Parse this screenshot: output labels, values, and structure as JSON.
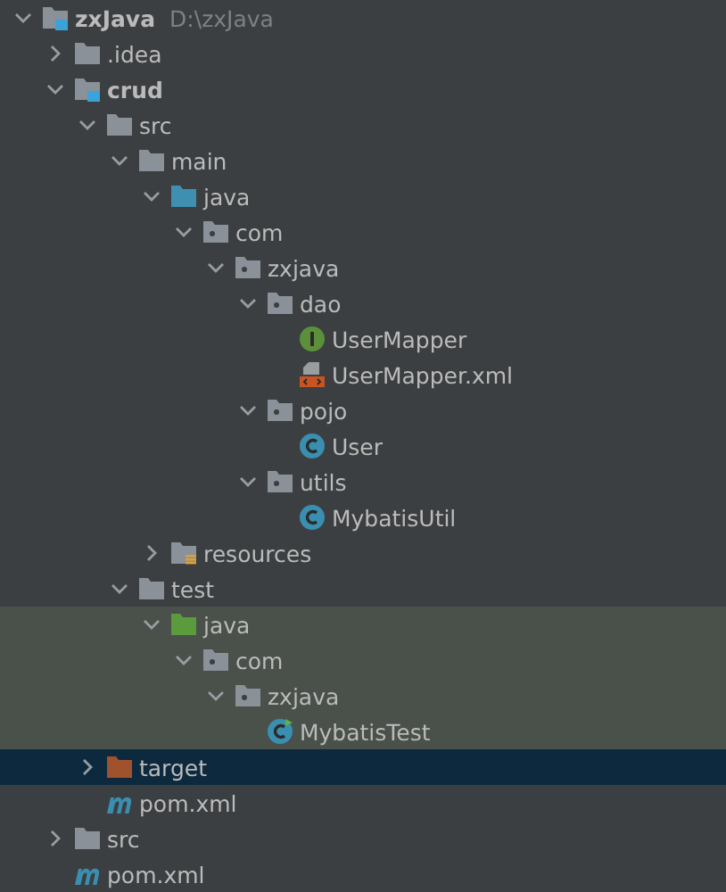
{
  "tree": [
    {
      "label": "zxJava",
      "path": "D:\\zxJava",
      "kind": "module",
      "expanded": true,
      "selected": false,
      "highlighted": false,
      "children": [
        {
          "label": ".idea",
          "kind": "folder",
          "expanded": false,
          "selected": false,
          "highlighted": false
        },
        {
          "label": "crud",
          "kind": "module",
          "expanded": true,
          "selected": false,
          "highlighted": false,
          "children": [
            {
              "label": "src",
              "kind": "folder",
              "expanded": true,
              "selected": false,
              "highlighted": false,
              "children": [
                {
                  "label": "main",
                  "kind": "folder",
                  "expanded": true,
                  "selected": false,
                  "highlighted": false,
                  "children": [
                    {
                      "label": "java",
                      "kind": "source",
                      "expanded": true,
                      "selected": false,
                      "highlighted": false,
                      "children": [
                        {
                          "label": "com",
                          "kind": "package",
                          "expanded": true,
                          "selected": false,
                          "highlighted": false,
                          "children": [
                            {
                              "label": "zxjava",
                              "kind": "package",
                              "expanded": true,
                              "selected": false,
                              "highlighted": false,
                              "children": [
                                {
                                  "label": "dao",
                                  "kind": "package",
                                  "expanded": true,
                                  "selected": false,
                                  "highlighted": false,
                                  "children": [
                                    {
                                      "label": "UserMapper",
                                      "kind": "interface",
                                      "selected": false,
                                      "highlighted": false
                                    },
                                    {
                                      "label": "UserMapper.xml",
                                      "kind": "xml",
                                      "selected": false,
                                      "highlighted": false
                                    }
                                  ]
                                },
                                {
                                  "label": "pojo",
                                  "kind": "package",
                                  "expanded": true,
                                  "selected": false,
                                  "highlighted": false,
                                  "children": [
                                    {
                                      "label": "User",
                                      "kind": "class",
                                      "selected": false,
                                      "highlighted": false
                                    }
                                  ]
                                },
                                {
                                  "label": "utils",
                                  "kind": "package",
                                  "expanded": true,
                                  "selected": false,
                                  "highlighted": false,
                                  "children": [
                                    {
                                      "label": "MybatisUtil",
                                      "kind": "class",
                                      "selected": false,
                                      "highlighted": false
                                    }
                                  ]
                                }
                              ]
                            }
                          ]
                        }
                      ]
                    },
                    {
                      "label": "resources",
                      "kind": "resources",
                      "expanded": false,
                      "selected": false,
                      "highlighted": false
                    }
                  ]
                },
                {
                  "label": "test",
                  "kind": "folder",
                  "expanded": true,
                  "selected": false,
                  "highlighted": false,
                  "children": [
                    {
                      "label": "java",
                      "kind": "test-source",
                      "expanded": true,
                      "selected": false,
                      "highlighted": true,
                      "children": [
                        {
                          "label": "com",
                          "kind": "package",
                          "expanded": true,
                          "selected": false,
                          "highlighted": true,
                          "children": [
                            {
                              "label": "zxjava",
                              "kind": "package",
                              "expanded": true,
                              "selected": false,
                              "highlighted": true,
                              "children": [
                                {
                                  "label": "MybatisTest",
                                  "kind": "test-class",
                                  "selected": false,
                                  "highlighted": true
                                }
                              ]
                            }
                          ]
                        }
                      ]
                    }
                  ]
                }
              ]
            },
            {
              "label": "target",
              "kind": "excluded",
              "expanded": false,
              "selected": true,
              "highlighted": false
            },
            {
              "label": "pom.xml",
              "kind": "maven",
              "selected": false,
              "highlighted": false
            }
          ]
        },
        {
          "label": "src",
          "kind": "folder",
          "expanded": false,
          "selected": false,
          "highlighted": false
        },
        {
          "label": "pom.xml",
          "kind": "maven",
          "selected": false,
          "highlighted": false
        }
      ]
    }
  ]
}
